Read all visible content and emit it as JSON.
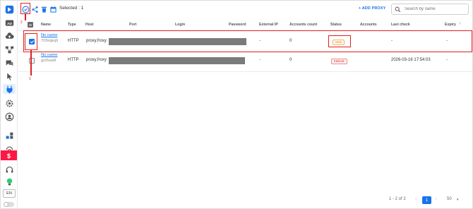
{
  "sidebar": {
    "items": [
      "logo-icon",
      "ad-icon",
      "cloud-upload-icon",
      "network-icon",
      "chat-icon",
      "cursor-icon",
      "proxy-plug-icon",
      "gear-icon",
      "user-circle-icon",
      "extensions-icon",
      "fingerprint-icon",
      "dollar-icon",
      "headset-icon",
      "lightbulb-icon"
    ],
    "language": "EN"
  },
  "toolbar": {
    "selected_label": "Selected : 1",
    "add_proxy_label": "+ ADD PROXY",
    "search_placeholder": "Search by name"
  },
  "table": {
    "headers": {
      "name": "Name",
      "type": "Type",
      "host": "Host",
      "port": "Port",
      "login": "Login",
      "password": "Password",
      "external_ip": "External IP",
      "accounts_count": "Accounts count",
      "status": "Status",
      "accounts": "Accounts",
      "last_check": "Last check",
      "expiry": "Expiry"
    },
    "rows": [
      {
        "name": "No name",
        "id": "709rqkq9",
        "type": "HTTP",
        "host": "proxy.froxy",
        "external_ip": "-",
        "accounts_count": "0",
        "status": "NEW",
        "accounts": "",
        "last_check": "-",
        "expiry": "-",
        "checked": true
      },
      {
        "name": "No name",
        "id": "gct5sw8",
        "type": "HTTP",
        "host": "proxy.froxy",
        "external_ip": "-",
        "accounts_count": "0",
        "status": "ERROR",
        "accounts": "",
        "last_check": "2026-03-16 17:54:03",
        "expiry": "-",
        "checked": false
      }
    ]
  },
  "pagination": {
    "range": "1 - 2 of 2",
    "current_page": "1",
    "per_page": "50"
  },
  "annotations": {
    "step1": "1",
    "step2": "2"
  },
  "colors": {
    "accent": "#1a73e8",
    "highlight": "#e02020",
    "sidebar_active": "#ff1744"
  }
}
